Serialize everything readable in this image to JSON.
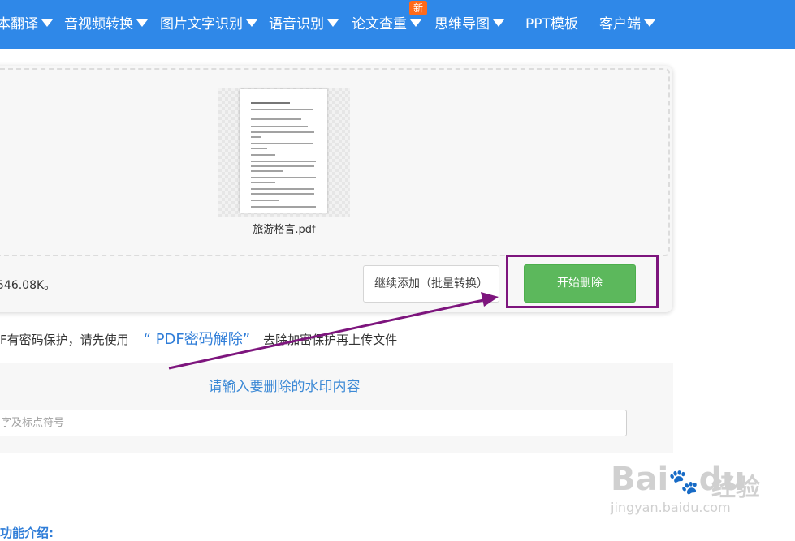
{
  "nav": {
    "items": [
      {
        "label": "本翻译",
        "has_dropdown": true
      },
      {
        "label": "音视频转换",
        "has_dropdown": true
      },
      {
        "label": "图片文字识别",
        "has_dropdown": true
      },
      {
        "label": "语音识别",
        "has_dropdown": true
      },
      {
        "label": "论文查重",
        "has_dropdown": true
      },
      {
        "label": "思维导图",
        "has_dropdown": true
      },
      {
        "label": "PPT模板",
        "has_dropdown": false
      },
      {
        "label": "客户端",
        "has_dropdown": true
      }
    ],
    "new_badge": "新",
    "bg_color": "#2f88e8"
  },
  "upload": {
    "file_name": "旅游格言.pdf",
    "size_info": "546.08K。",
    "add_button": "继续添加（批量转换）",
    "start_button": "开始删除",
    "start_button_color": "#5cb85c",
    "highlight_color": "#7d157d"
  },
  "notice": {
    "prefix": "F有密码保护，请先使用",
    "link": "“ PDF密码解除”",
    "suffix": "去除加密保护再上传文件"
  },
  "watermark": {
    "title": "请输入要删除的水印内容",
    "input_value": "",
    "placeholder": "字及标点符号"
  },
  "bottom_heading": "功能介绍:",
  "brand": {
    "name_latin": "Bai",
    "name_latin_2": "du",
    "name_cn": "经验",
    "url": "jingyan.baidu.com"
  }
}
